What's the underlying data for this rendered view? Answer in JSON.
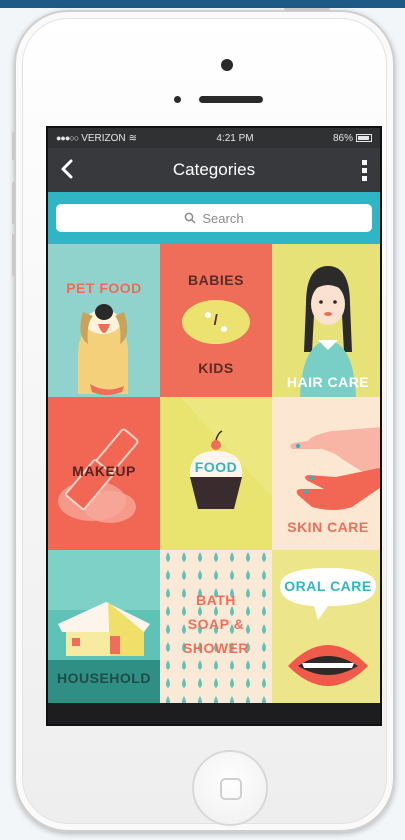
{
  "status_bar": {
    "carrier": "VERIZON",
    "time": "4:21 PM",
    "battery": "86%"
  },
  "nav": {
    "title": "Categories",
    "back_icon": "chevron-left-icon",
    "more_icon": "more-vertical-icon"
  },
  "search": {
    "placeholder": "Search",
    "icon": "search-icon"
  },
  "categories": [
    {
      "label": "PET FOOD",
      "bg": "#8fd3cc",
      "text_color": "#f06b55"
    },
    {
      "label_top": "BABIES",
      "slash": "/",
      "label_bottom": "KIDS",
      "bg": "#ef6e5a",
      "text_color": "#5e2a25"
    },
    {
      "label": "HAIR CARE",
      "bg": "#e6e277",
      "text_color": "#ffffff"
    },
    {
      "label": "MAKEUP",
      "bg": "#f26754",
      "text_color": "#5a2420"
    },
    {
      "label": "FOOD",
      "bg": "#e9e36f",
      "text_color": "#ffffff"
    },
    {
      "label": "SKIN CARE",
      "bg": "#fbe7d2",
      "text_color": "#ef6e5a"
    },
    {
      "label": "HOUSEHOLD",
      "bg": "#5fc2b7",
      "text_color": "#1e4c47"
    },
    {
      "label": "BATH SOAP & SHOWER",
      "label_lines": [
        "BATH",
        "SOAP &",
        "SHOWER"
      ],
      "bg": "#fbe9d7",
      "text_color": "#ef6e5a"
    },
    {
      "label": "ORAL CARE",
      "bg": "#ece58a",
      "text_color": "#2fb5c4"
    }
  ]
}
